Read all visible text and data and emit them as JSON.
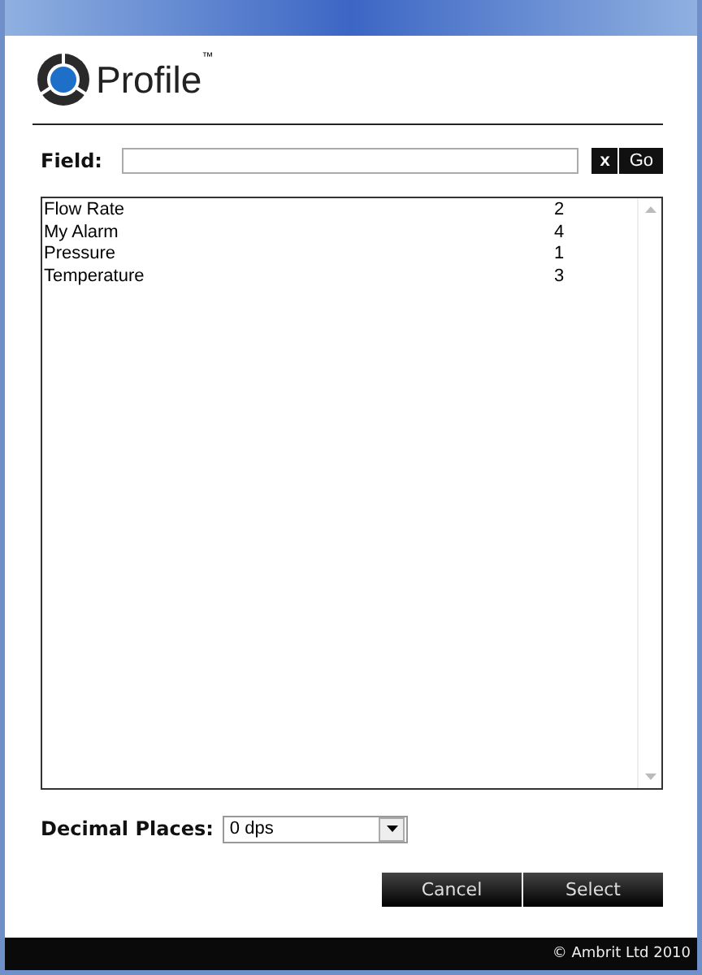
{
  "logo": {
    "name": "Profile",
    "trademark": "™"
  },
  "field": {
    "label": "Field:",
    "clear_button": "x",
    "go_button": "Go"
  },
  "list": {
    "rows": [
      {
        "name": "Flow Rate",
        "value": "2"
      },
      {
        "name": "My Alarm",
        "value": "4"
      },
      {
        "name": "Pressure",
        "value": "1"
      },
      {
        "name": "Temperature",
        "value": "3"
      }
    ]
  },
  "decimal_places": {
    "label": "Decimal Places:",
    "value": "0 dps"
  },
  "buttons": [
    "Cancel",
    "Select"
  ],
  "footer": "© Ambrit Ltd 2010"
}
